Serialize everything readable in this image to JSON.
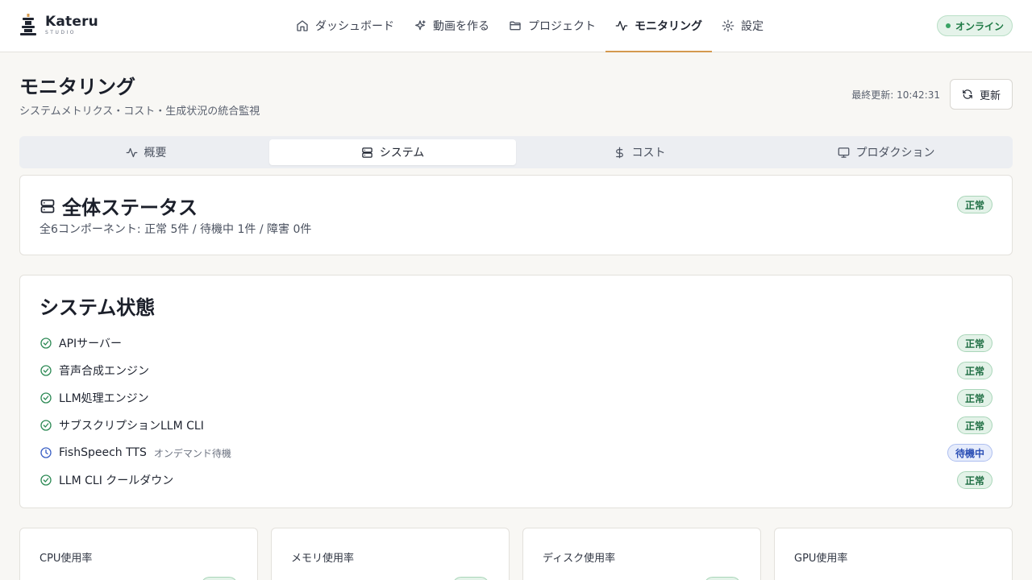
{
  "brand": {
    "name": "Kateru",
    "sub": "STUDIO"
  },
  "nav": [
    {
      "label": "ダッシュボード",
      "icon": "home-icon"
    },
    {
      "label": "動画を作る",
      "icon": "sparkles-icon"
    },
    {
      "label": "プロジェクト",
      "icon": "folder-icon"
    },
    {
      "label": "モニタリング",
      "icon": "activity-icon",
      "active": true
    },
    {
      "label": "設定",
      "icon": "gear-icon"
    }
  ],
  "status_indicator": {
    "label": "オンライン",
    "color": "#3aa465"
  },
  "page": {
    "title": "モニタリング",
    "subtitle": "システムメトリクス・コスト・生成状況の統合監視",
    "last_updated": "最終更新: 10:42:31",
    "refresh_label": "更新"
  },
  "tabs": [
    {
      "label": "概要",
      "icon": "activity-icon"
    },
    {
      "label": "システム",
      "icon": "server-icon",
      "active": true
    },
    {
      "label": "コスト",
      "icon": "dollar-icon"
    },
    {
      "label": "プロダクション",
      "icon": "monitor-icon"
    }
  ],
  "overall": {
    "title": "全体ステータス",
    "summary": "全6コンポーネント: 正常 5件 / 待機中 1件 / 障害 0件",
    "badge": "正常"
  },
  "system": {
    "title": "システム状態",
    "components": [
      {
        "name": "APIサーバー",
        "note": "",
        "status": "正常",
        "state": "ok"
      },
      {
        "name": "音声合成エンジン",
        "note": "",
        "status": "正常",
        "state": "ok"
      },
      {
        "name": "LLM処理エンジン",
        "note": "",
        "status": "正常",
        "state": "ok"
      },
      {
        "name": "サブスクリプションLLM CLI",
        "note": "",
        "status": "正常",
        "state": "ok"
      },
      {
        "name": "FishSpeech TTS",
        "note": "オンデマンド待機",
        "status": "待機中",
        "state": "wait"
      },
      {
        "name": "LLM CLI クールダウン",
        "note": "",
        "status": "正常",
        "state": "ok"
      }
    ]
  },
  "metrics": [
    {
      "label": "CPU使用率"
    },
    {
      "label": "メモリ使用率"
    },
    {
      "label": "ディスク使用率"
    },
    {
      "label": "GPU使用率"
    }
  ],
  "colors": {
    "accent": "#d4994e",
    "ok": "#1f6e43",
    "wait": "#2b4fb5"
  }
}
